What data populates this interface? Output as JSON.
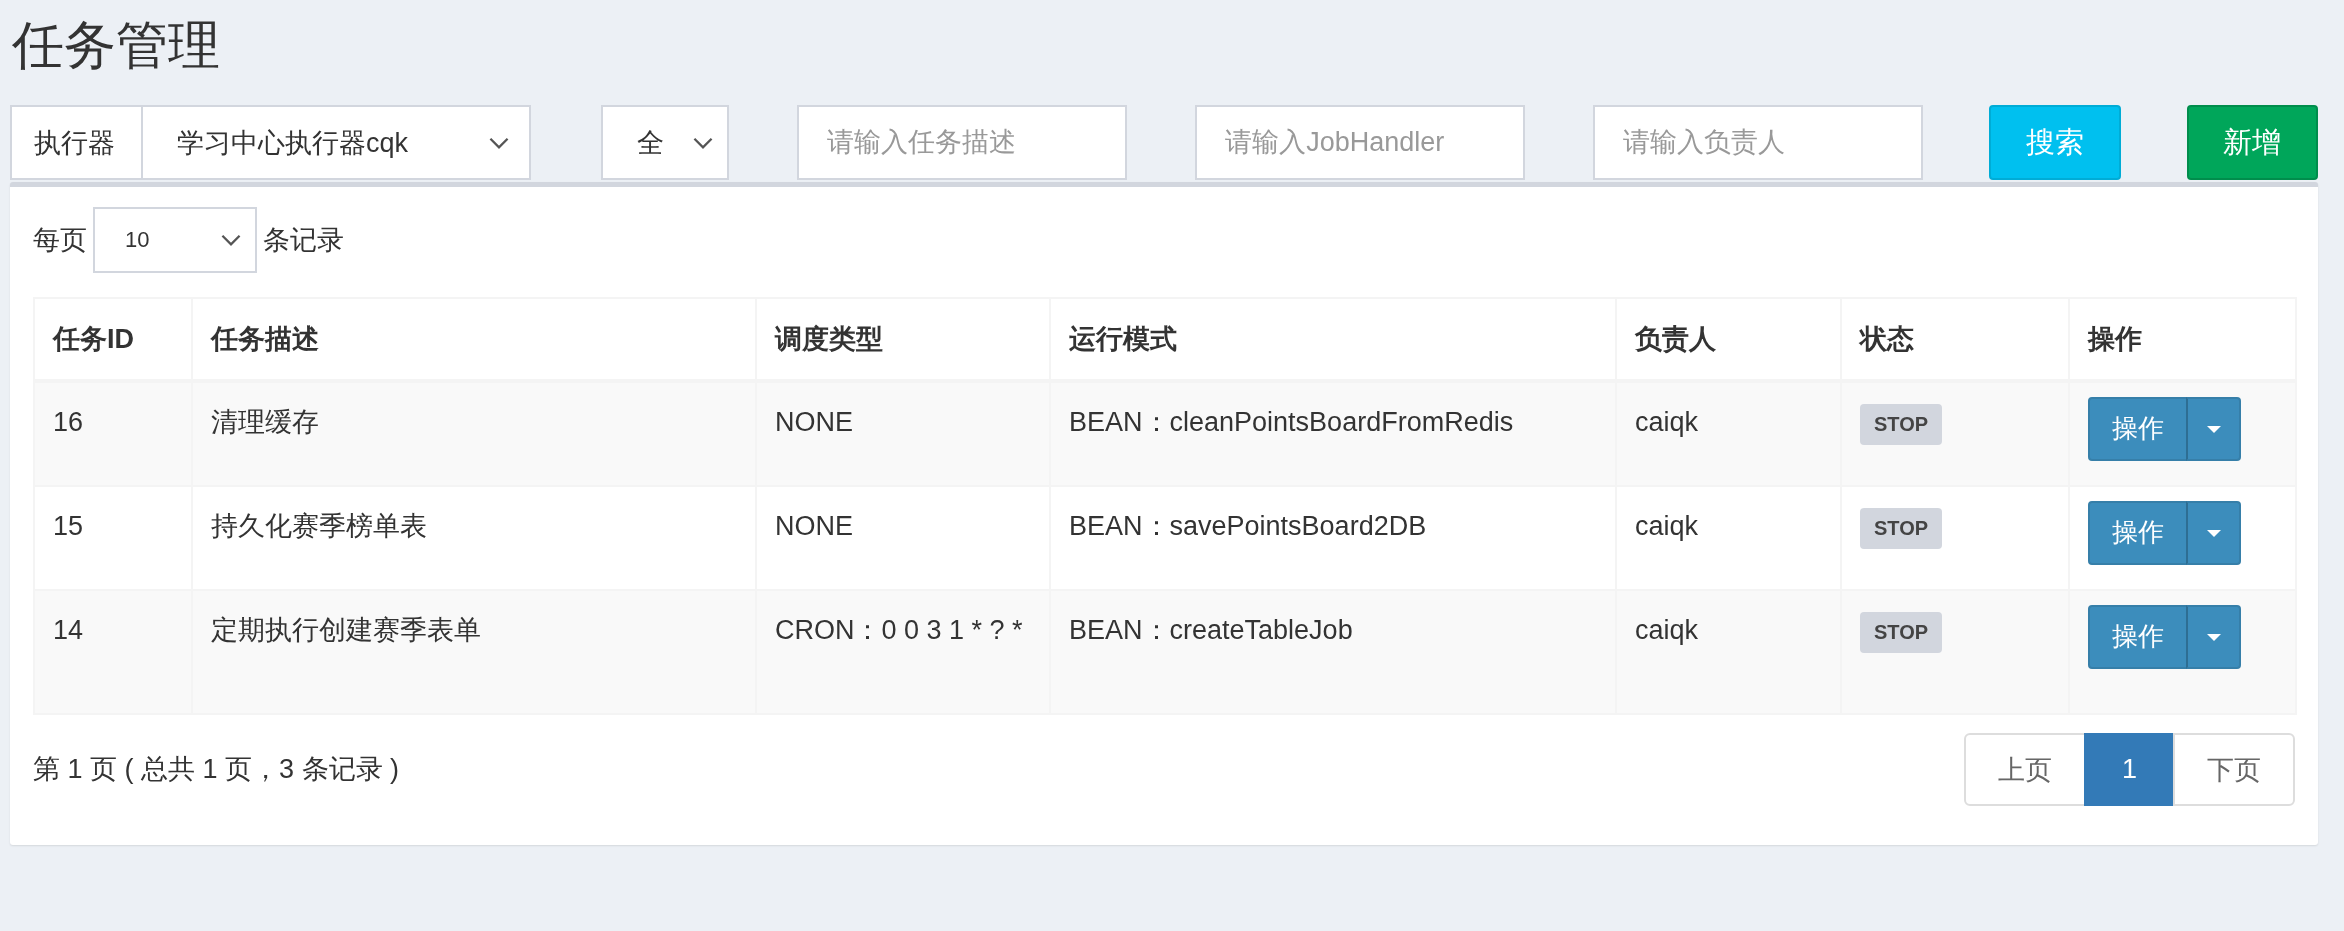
{
  "page_title": "任务管理",
  "filters": {
    "executor_label": "执行器",
    "executor_value": "学习中心执行器cqk",
    "status_value": "全",
    "inputs": [
      {
        "placeholder": "请输入任务描述"
      },
      {
        "placeholder": "请输入JobHandler"
      },
      {
        "placeholder": "请输入负责人"
      }
    ],
    "buttons": [
      {
        "label": "搜索",
        "kind": "search"
      },
      {
        "label": "新增",
        "kind": "add"
      }
    ]
  },
  "page_size": {
    "prefix": "每页",
    "value": "10",
    "suffix": "条记录"
  },
  "table": {
    "columns": [
      "任务ID",
      "任务描述",
      "调度类型",
      "运行模式",
      "负责人",
      "状态",
      "操作"
    ],
    "rows": [
      {
        "id": "16",
        "desc": "清理缓存",
        "schedule": "NONE",
        "mode": "BEAN：cleanPointsBoardFromRedis",
        "owner": "caiqk",
        "status": "STOP",
        "action": "操作"
      },
      {
        "id": "15",
        "desc": "持久化赛季榜单表",
        "schedule": "NONE",
        "mode": "BEAN：savePointsBoard2DB",
        "owner": "caiqk",
        "status": "STOP",
        "action": "操作"
      },
      {
        "id": "14",
        "desc": "定期执行创建赛季表单",
        "schedule": "CRON：0 0 3 1 * ? *",
        "mode": "BEAN：createTableJob",
        "owner": "caiqk",
        "status": "STOP",
        "action": "操作"
      }
    ]
  },
  "footer": {
    "summary": "第 1 页 ( 总共 1 页，3 条记录 )",
    "pagination": [
      {
        "label": "上页",
        "selected": false
      },
      {
        "label": "1",
        "selected": true
      },
      {
        "label": "下页",
        "selected": false
      }
    ]
  }
}
